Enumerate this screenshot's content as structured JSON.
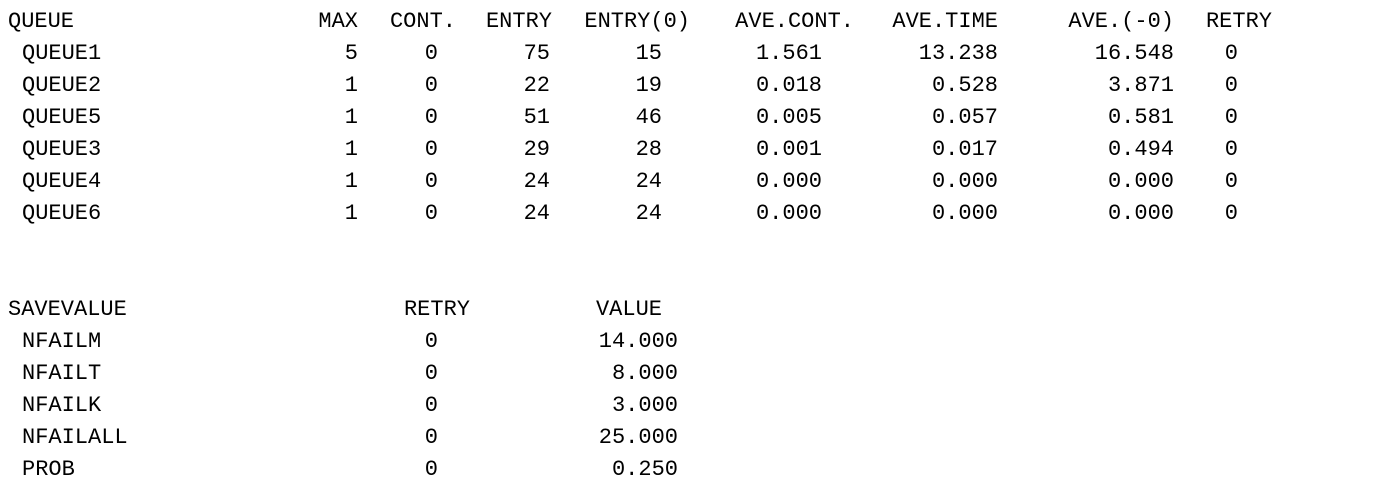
{
  "queue_table": {
    "headers": [
      "QUEUE",
      "MAX",
      "CONT.",
      "ENTRY",
      "ENTRY(0)",
      "AVE.CONT.",
      "AVE.TIME",
      "AVE.(-0)",
      "RETRY"
    ],
    "rows": [
      [
        "QUEUE1",
        "5",
        "0",
        "75",
        "15",
        "1.561",
        "13.238",
        "16.548",
        "0"
      ],
      [
        "QUEUE2",
        "1",
        "0",
        "22",
        "19",
        "0.018",
        "0.528",
        "3.871",
        "0"
      ],
      [
        "QUEUE5",
        "1",
        "0",
        "51",
        "46",
        "0.005",
        "0.057",
        "0.581",
        "0"
      ],
      [
        "QUEUE3",
        "1",
        "0",
        "29",
        "28",
        "0.001",
        "0.017",
        "0.494",
        "0"
      ],
      [
        "QUEUE4",
        "1",
        "0",
        "24",
        "24",
        "0.000",
        "0.000",
        "0.000",
        "0"
      ],
      [
        "QUEUE6",
        "1",
        "0",
        "24",
        "24",
        "0.000",
        "0.000",
        "0.000",
        "0"
      ]
    ]
  },
  "savevalue_table": {
    "headers": [
      "SAVEVALUE",
      "RETRY",
      "VALUE"
    ],
    "rows": [
      [
        "NFAILM",
        "0",
        "14.000"
      ],
      [
        "NFAILT",
        "0",
        "8.000"
      ],
      [
        "NFAILK",
        "0",
        "3.000"
      ],
      [
        "NFAILALL",
        "0",
        "25.000"
      ],
      [
        "PROB",
        "0",
        "0.250"
      ]
    ]
  }
}
